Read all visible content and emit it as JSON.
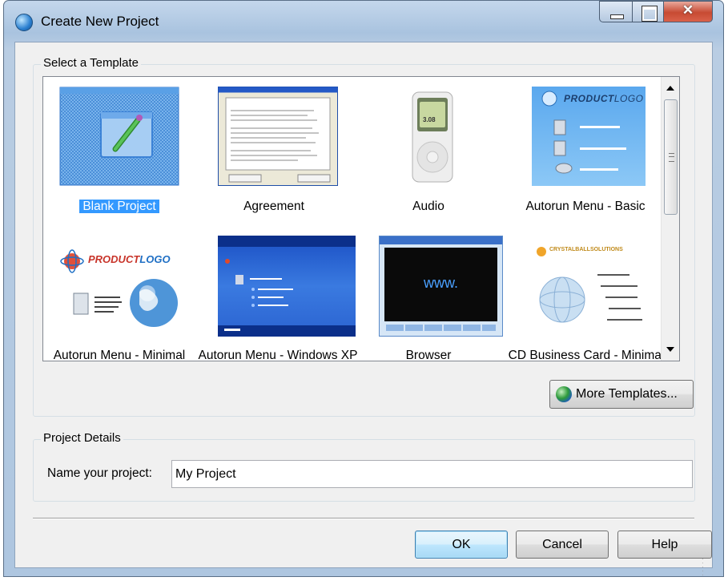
{
  "window": {
    "title": "Create New Project",
    "accent": "#3399ff"
  },
  "templates_group": {
    "label": "Select a Template",
    "items": [
      {
        "label": "Blank Project",
        "selected": true
      },
      {
        "label": "Agreement"
      },
      {
        "label": "Audio"
      },
      {
        "label": "Autorun Menu - Basic"
      },
      {
        "label": "Autorun Menu - Minimal"
      },
      {
        "label": "Autorun Menu - Windows XP Theme"
      },
      {
        "label": "Browser"
      },
      {
        "label": "CD Business Card - Minimal"
      }
    ],
    "thumb_text": {
      "audio_display": "3.08",
      "productlogo_bold": "PRODUCT",
      "productlogo_italic": "LOGO",
      "browser": "www.",
      "crystalball": "CRYSTALBALLSOLUTIONS"
    },
    "more_templates_label": "More Templates..."
  },
  "details_group": {
    "label": "Project Details",
    "name_label": "Name your project:",
    "name_value": "My Project"
  },
  "buttons": {
    "ok": "OK",
    "cancel": "Cancel",
    "help": "Help"
  }
}
